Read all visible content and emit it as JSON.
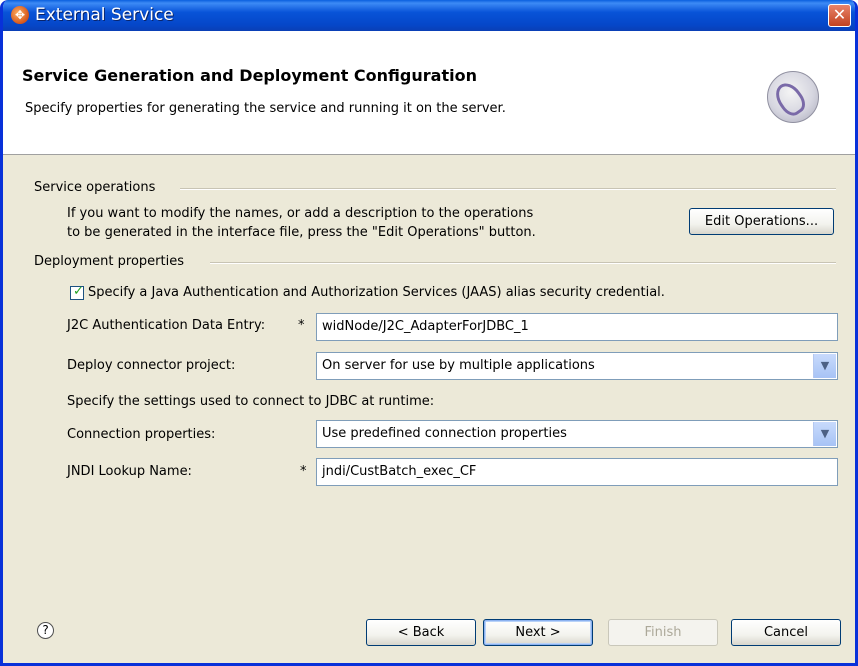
{
  "window": {
    "title": "External Service",
    "close_glyph": "✕"
  },
  "header": {
    "title": "Service Generation and Deployment Configuration",
    "description": "Specify properties for generating the service and running it on the server."
  },
  "service_operations": {
    "label": "Service operations",
    "description_line1": "If you want to modify the names, or add a description to the operations",
    "description_line2": "to be generated in the interface file, press the \"Edit Operations\" button.",
    "edit_button": "Edit Operations..."
  },
  "deployment": {
    "label": "Deployment properties",
    "jaas_checkbox_label": "Specify a Java Authentication and Authorization Services (JAAS) alias security credential.",
    "jaas_checked": true,
    "j2c_label": "J2C Authentication Data Entry:",
    "j2c_required": "*",
    "j2c_value": "widNode/J2C_AdapterForJDBC_1",
    "deploy_label": "Deploy connector project:",
    "deploy_value": "On server for use by multiple applications",
    "runtime_text": "Specify the settings used to connect to JDBC at runtime:",
    "connection_label": "Connection properties:",
    "connection_value": "Use predefined connection properties",
    "jndi_label": "JNDI Lookup Name:",
    "jndi_required": "*",
    "jndi_value": "jndi/CustBatch_exec_CF"
  },
  "footer": {
    "help_glyph": "?",
    "back": "< Back",
    "next": "Next >",
    "finish": "Finish",
    "cancel": "Cancel"
  },
  "icons": {
    "app": "external-service-icon",
    "wizard_graphic": "wizard-banner-icon",
    "help": "help-icon",
    "dropdown": "chevron-down-icon"
  },
  "colors": {
    "titlebar": "#0853d8",
    "dialog_bg": "#ece9d8",
    "button_border": "#003c74",
    "checkmark": "#21a121"
  }
}
